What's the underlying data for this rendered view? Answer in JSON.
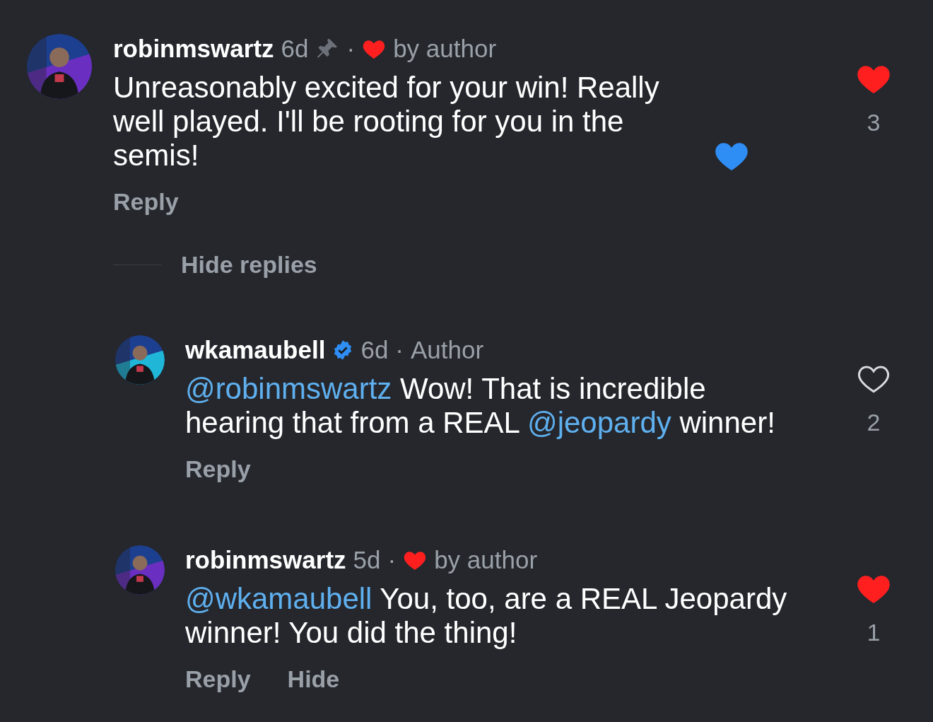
{
  "comments": [
    {
      "avatar": {
        "kind": "picture",
        "color": "#6a2fc0"
      },
      "username": "robinmswartz",
      "verified": false,
      "time": "6d",
      "pinned": true,
      "separator": "·",
      "badge": {
        "kind": "liked",
        "label": "by author"
      },
      "text": [
        {
          "kind": "text",
          "text": "Unreasonably excited for your win! Really well played. I'll be rooting for you in the semis!"
        }
      ],
      "end_icon": {
        "kind": "heart",
        "color": "#2f8ef5"
      },
      "actions": [
        "Reply"
      ],
      "liked": true,
      "like_count": "3",
      "replies_toggle": {
        "label": "Hide replies"
      },
      "replies": [
        {
          "avatar": {
            "kind": "picture",
            "color": "#1fb6d8"
          },
          "username": "wkamaubell",
          "verified": true,
          "time": "6d",
          "pinned": false,
          "separator": "·",
          "badge": {
            "kind": "author",
            "label": "Author"
          },
          "text": [
            {
              "kind": "mention",
              "text": "@robinmswartz"
            },
            {
              "kind": "text",
              "text": " Wow! That is incredible hearing that from a REAL "
            },
            {
              "kind": "mention",
              "text": "@jeopardy"
            },
            {
              "kind": "text",
              "text": " winner!"
            }
          ],
          "actions": [
            "Reply"
          ],
          "liked": false,
          "like_count": "2"
        },
        {
          "avatar": {
            "kind": "picture",
            "color": "#6a2fc0"
          },
          "username": "robinmswartz",
          "verified": false,
          "time": "5d",
          "pinned": false,
          "separator": "·",
          "badge": {
            "kind": "liked",
            "label": "by author"
          },
          "text": [
            {
              "kind": "mention",
              "text": "@wkamaubell"
            },
            {
              "kind": "text",
              "text": " You, too, are a REAL Jeopardy winner! You did the thing!"
            }
          ],
          "actions": [
            "Reply",
            "Hide"
          ],
          "liked": true,
          "like_count": "1"
        }
      ]
    }
  ]
}
